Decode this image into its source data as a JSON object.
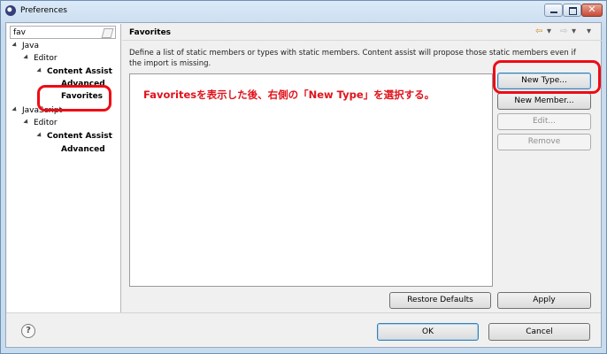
{
  "window": {
    "title": "Preferences"
  },
  "filter": {
    "value": "fav"
  },
  "tree": [
    {
      "label": "Java",
      "level": 0,
      "expanded": true,
      "bold": false
    },
    {
      "label": "Editor",
      "level": 1,
      "expanded": true,
      "bold": false
    },
    {
      "label": "Content Assist",
      "level": 2,
      "expanded": true,
      "bold": true
    },
    {
      "label": "Advanced",
      "level": 3,
      "expanded": false,
      "bold": true
    },
    {
      "label": "Favorites",
      "level": 3,
      "expanded": false,
      "bold": true
    },
    {
      "label": "JavaScript",
      "level": 0,
      "expanded": true,
      "bold": false
    },
    {
      "label": "Editor",
      "level": 1,
      "expanded": true,
      "bold": false
    },
    {
      "label": "Content Assist",
      "level": 2,
      "expanded": true,
      "bold": true
    },
    {
      "label": "Advanced",
      "level": 3,
      "expanded": false,
      "bold": true
    }
  ],
  "page": {
    "title": "Favorites",
    "description": "Define a list of static members or types with static members. Content assist will propose those static members even if the import is missing."
  },
  "annotation": "Favoritesを表示した後、右側の「New Type」を選択する。",
  "buttons": {
    "new_type": "New Type...",
    "new_member": "New Member...",
    "edit": "Edit...",
    "remove": "Remove",
    "restore_defaults": "Restore Defaults",
    "apply": "Apply",
    "ok": "OK",
    "cancel": "Cancel"
  },
  "icons": {
    "help": "?",
    "back": "⇦",
    "forward": "⇨",
    "dropdown": "▾"
  },
  "colors": {
    "highlight": "#ef0b14",
    "annotation": "#e0131b"
  }
}
